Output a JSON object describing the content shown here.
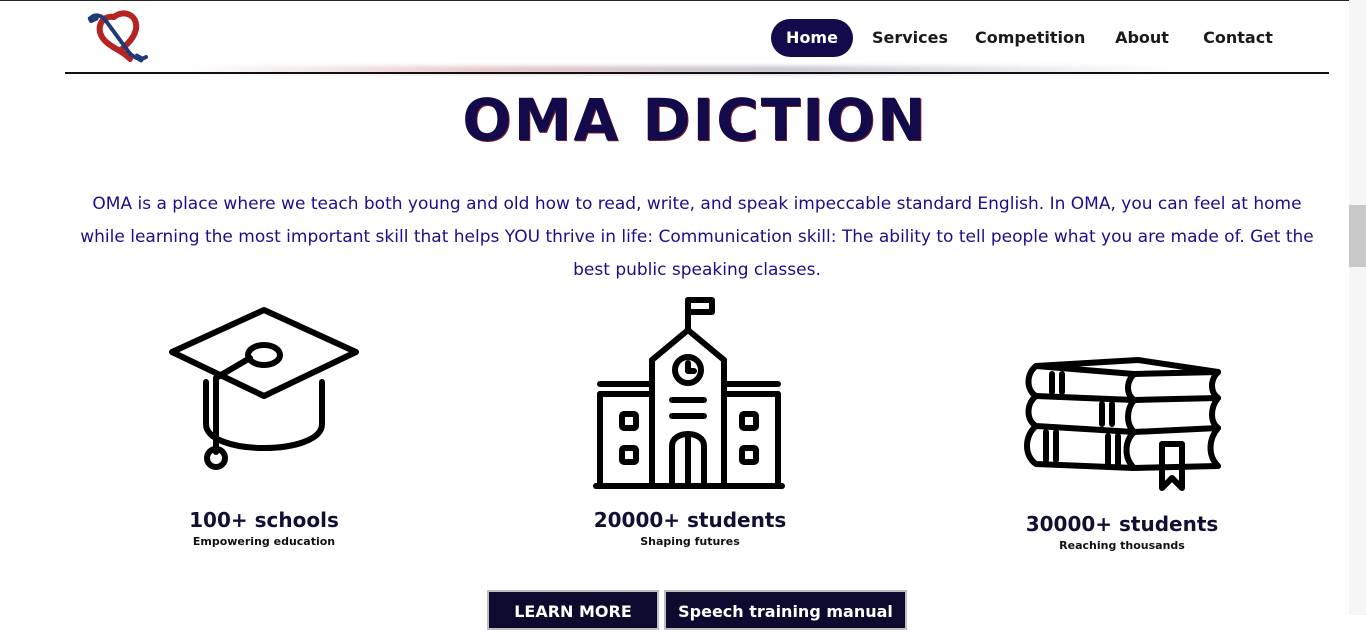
{
  "nav": {
    "items": [
      {
        "label": "Home",
        "active": true
      },
      {
        "label": "Services",
        "active": false
      },
      {
        "label": "Competition",
        "active": false
      },
      {
        "label": "About",
        "active": false
      },
      {
        "label": "Contact",
        "active": false
      }
    ]
  },
  "hero": {
    "title": "OMA DICTION",
    "intro": "OMA is a place where we teach both young and old how to read, write, and speak impeccable standard English. In OMA, you can feel at home while learning the most important skill that helps YOU thrive in life: Communication skill: The ability to tell people what you are made of. Get the best public speaking classes."
  },
  "stats": [
    {
      "icon": "graduation-cap-icon",
      "title": "100+ schools",
      "subtitle": "Empowering education"
    },
    {
      "icon": "school-building-icon",
      "title": "20000+ students",
      "subtitle": "Shaping futures"
    },
    {
      "icon": "books-icon",
      "title": "30000+ students",
      "subtitle": "Reaching thousands"
    }
  ],
  "buttons": {
    "learn_more": "LEARN MORE",
    "manual": "Speech training manual"
  },
  "colors": {
    "brand_navy": "#120a4a",
    "text_blue": "#1e0d8a",
    "logo_red": "#b52323"
  }
}
